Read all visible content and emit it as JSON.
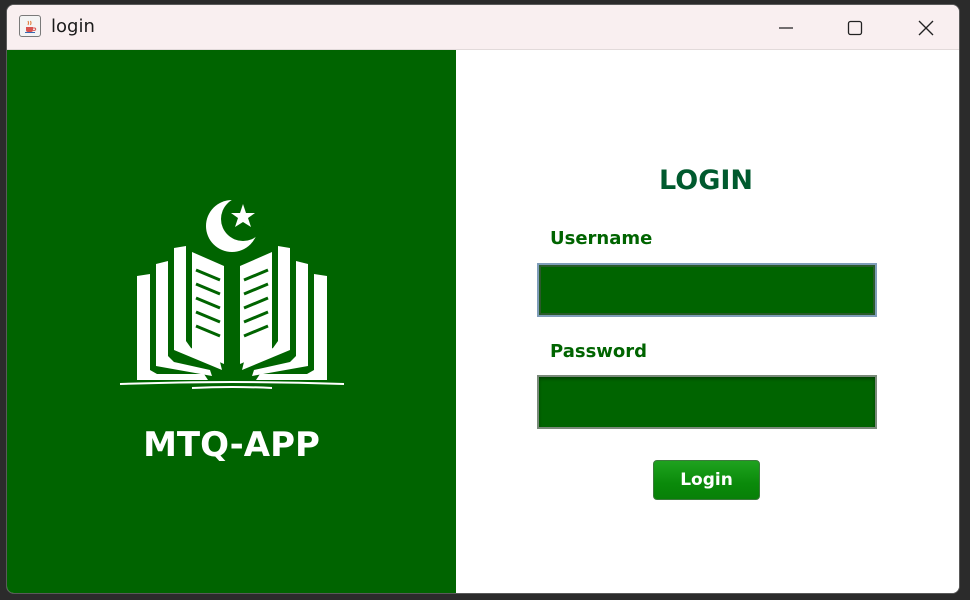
{
  "window": {
    "title": "login",
    "icon": "java-cup-icon",
    "controls": [
      "minimize-icon",
      "maximize-icon",
      "close-icon"
    ]
  },
  "brand": {
    "app_name": "MTQ-APP",
    "logo": "crescent-star-book-icon"
  },
  "form": {
    "heading": "LOGIN",
    "username_label": "Username",
    "username_value": "",
    "password_label": "Password",
    "password_value": "",
    "submit_label": "Login"
  },
  "colors": {
    "primary_green": "#006400",
    "heading_green": "#005a2e",
    "button_green": "#0a8a0a",
    "titlebar": "#f9eff0"
  }
}
